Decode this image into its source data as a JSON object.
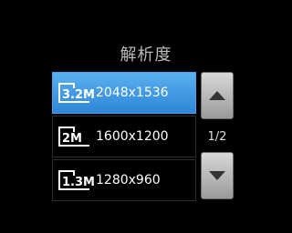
{
  "title": "解析度",
  "resolutions": [
    {
      "mp": "3.2M",
      "label": "2048x1536",
      "selected": true
    },
    {
      "mp": "2M",
      "label": "1600x1200",
      "selected": false
    },
    {
      "mp": "1.3M",
      "label": "1280x960",
      "selected": false
    }
  ],
  "pager": {
    "indicator": "1/2"
  },
  "icons": {
    "up": "chevron-up-icon",
    "down": "chevron-down-icon"
  }
}
